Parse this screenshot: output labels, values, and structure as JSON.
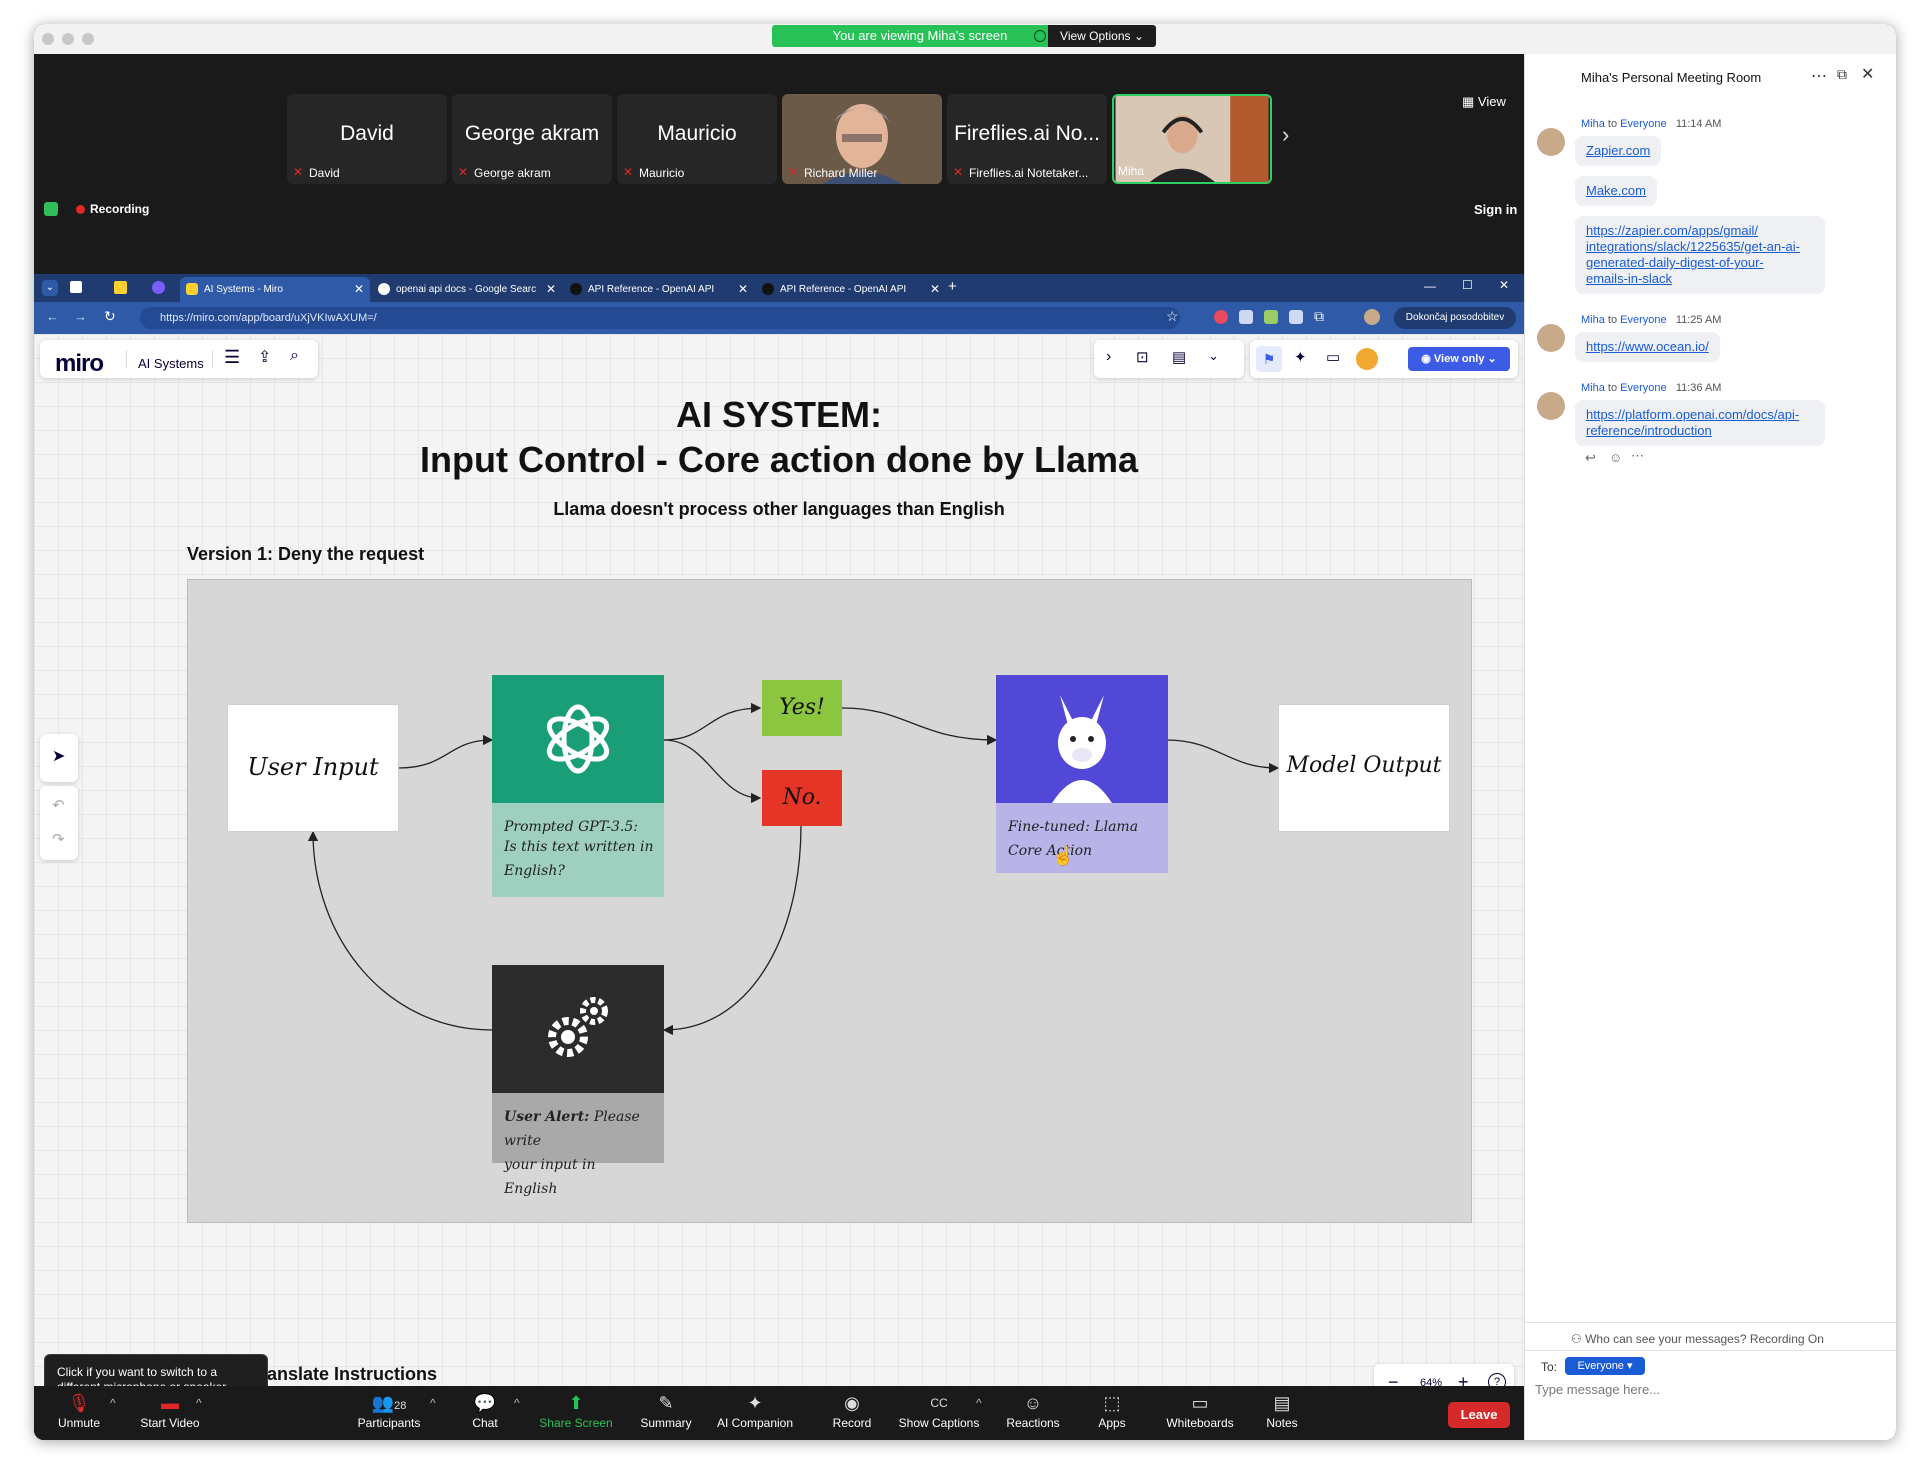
{
  "banner": {
    "text": "You are viewing Miha's screen",
    "view_options": "View Options"
  },
  "participants_strip": [
    {
      "big": "David",
      "small": "David"
    },
    {
      "big": "George akram",
      "small": "George akram"
    },
    {
      "big": "Mauricio",
      "small": "Mauricio"
    },
    {
      "big": "",
      "small": "Richard Miller"
    },
    {
      "big": "Fireflies.ai No...",
      "small": "Fireflies.ai Notetaker..."
    },
    {
      "big": "",
      "small": "Miha"
    }
  ],
  "zoom_top": {
    "view": "View",
    "recording": "Recording",
    "sign_in": "Sign in"
  },
  "browser": {
    "tabs": [
      {
        "label": "AI Systems - Miro"
      },
      {
        "label": "openai api docs - Google Searc"
      },
      {
        "label": "API Reference - OpenAI API"
      },
      {
        "label": "API Reference - OpenAI API"
      }
    ],
    "url": "https://miro.com/app/board/uXjVKIwAXUM=/",
    "update_button": "Dokončaj posodobitev"
  },
  "miro": {
    "logo": "miro",
    "board_name": "AI Systems",
    "view_only": "View only",
    "title_line1": "AI SYSTEM:",
    "title_line2": "Input Control - Core action done by Llama",
    "subtitle": "Llama doesn't process other languages than English",
    "version1": "Version 1: Deny the request",
    "version2_partial": ": Translate Instructions",
    "zoom_level": "64%",
    "diagram": {
      "user_input": "User Input",
      "gpt_caption_1": "Prompted GPT-3.5:",
      "gpt_caption_2": "Is this text written in",
      "gpt_caption_3": "English?",
      "yes": "Yes!",
      "no": "No.",
      "llama_caption_1": "Fine-tuned: Llama",
      "llama_caption_2": "Core Action",
      "model_output": "Model Output",
      "alert_caption_bold": "User Alert:",
      "alert_caption_1": "Please write",
      "alert_caption_2": "your input in English"
    }
  },
  "tooltip": "Click if you want to switch to a different microphone or speaker",
  "toolbar": {
    "unmute": "Unmute",
    "start_video": "Start Video",
    "participants": "Participants",
    "participants_count": "28",
    "chat": "Chat",
    "share_screen": "Share Screen",
    "summary": "Summary",
    "ai_companion": "AI Companion",
    "record": "Record",
    "show_captions": "Show Captions",
    "captions_icon": "CC",
    "reactions": "Reactions",
    "apps": "Apps",
    "whiteboards": "Whiteboards",
    "notes": "Notes",
    "leave": "Leave"
  },
  "chat": {
    "title": "Miha's Personal Meeting Room",
    "messages": [
      {
        "from": "Miha",
        "to_word": "to",
        "to": "Everyone",
        "time": "11:14 AM",
        "links": [
          "Zapier.com",
          "Make.com",
          "https://zapier.com/apps/gmail/",
          "integrations/slack/1225635/get-an-ai-",
          "generated-daily-digest-of-your-",
          "emails-in-slack"
        ]
      },
      {
        "from": "Miha",
        "to_word": "to",
        "to": "Everyone",
        "time": "11:25 AM",
        "links": [
          "https://www.ocean.io/"
        ]
      },
      {
        "from": "Miha",
        "to_word": "to",
        "to": "Everyone",
        "time": "11:36 AM",
        "links": [
          "https://platform.openai.com/docs/api-",
          "reference/introduction"
        ]
      }
    ],
    "who_can_see": "Who can see your messages? Recording On",
    "to_label": "To:",
    "to_value": "Everyone",
    "placeholder": "Type message here..."
  },
  "colors": {
    "gpt": "#1a9e78",
    "yes": "#8cc63f",
    "no": "#e53527",
    "llama": "#5248d8",
    "alert": "#2b2b2b",
    "share_green": "#27c157",
    "leave": "#d62a2a"
  }
}
